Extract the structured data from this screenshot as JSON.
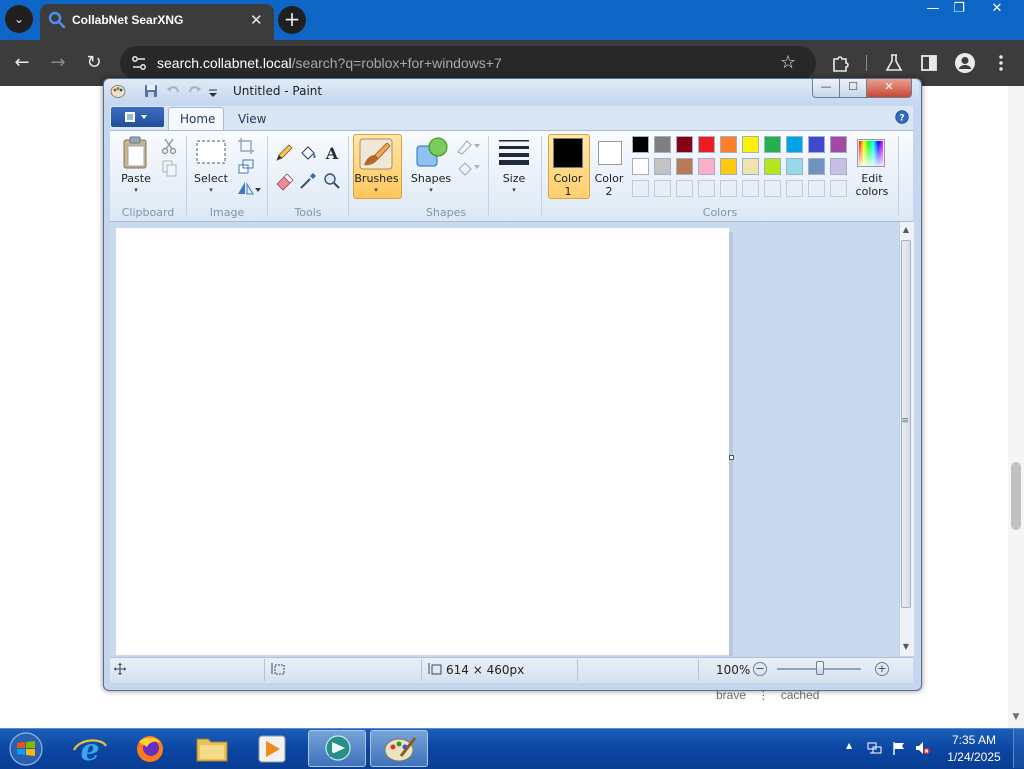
{
  "browser": {
    "tab_title": "CollabNet SearXNG",
    "tab_close": "✕",
    "new_tab": "+",
    "tab_list": "⌄",
    "url_host": "search.collabnet.local",
    "url_path": "/search?q=roblox+for+windows+7",
    "window_controls": {
      "minimize": "—",
      "restore": "❐",
      "close": "✕"
    },
    "nav": {
      "back": "←",
      "forward": "→",
      "reload": "↻"
    },
    "bookmark": "☆"
  },
  "page": {
    "snippet_left": "brave",
    "snippet_sep": "⋮",
    "snippet_right": "cached"
  },
  "paint": {
    "title": "Untitled - Paint",
    "window_controls": {
      "minimize": "—",
      "maximize": "☐",
      "close": "✕"
    },
    "tabs": {
      "home": "Home",
      "view": "View"
    },
    "help": "?",
    "groups": {
      "clipboard": "Clipboard",
      "image": "Image",
      "tools": "Tools",
      "shapes": "Shapes",
      "colors": "Colors"
    },
    "buttons": {
      "paste": "Paste",
      "select": "Select",
      "brushes": "Brushes",
      "shapes": "Shapes",
      "size": "Size",
      "color1_line1": "Color",
      "color1_line2": "1",
      "color2_line1": "Color",
      "color2_line2": "2",
      "edit_colors_line1": "Edit",
      "edit_colors_line2": "colors",
      "dropdown": "▾"
    },
    "palette_row1": [
      "#000000",
      "#7f7f7f",
      "#880015",
      "#ed1c24",
      "#ff7f27",
      "#fff200",
      "#22b14c",
      "#00a2e8",
      "#3f48cc",
      "#a349a4"
    ],
    "palette_row2": [
      "#ffffff",
      "#c3c3c3",
      "#b97a57",
      "#ffaec9",
      "#ffc90e",
      "#efe4b0",
      "#b5e61d",
      "#99d9ea",
      "#7092be",
      "#c8bfe7"
    ],
    "palette_row3_empty_count": 10,
    "color1": "#000000",
    "color2": "#ffffff",
    "status": {
      "image_size": "614 × 460px",
      "zoom": "100%",
      "zoom_out": "−",
      "zoom_in": "+"
    },
    "scroll": {
      "up": "▲",
      "down": "▼",
      "grip": "≡"
    }
  },
  "taskbar": {
    "time": "7:35 AM",
    "date": "1/24/2025",
    "tray_arrow": "▲"
  },
  "colors": {
    "browser_titlebar": "#0d66c6",
    "browser_toolbar": "#3c3c3c",
    "taskbar": "#0b46a3",
    "brushes_active": "#ffc75c"
  }
}
